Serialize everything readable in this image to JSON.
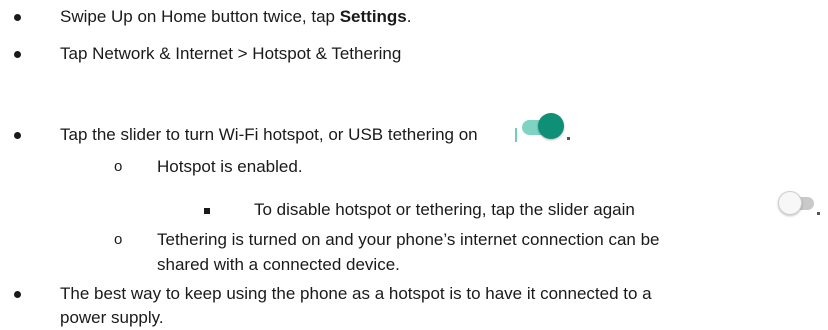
{
  "steps": {
    "step1_pre": "Swipe Up on Home button twice, tap ",
    "step1_bold": "Settings",
    "step1_post": ".",
    "step2": "Tap Network & Internet > Hotspot & Tethering",
    "step3": "Tap the slider to turn Wi-Fi hotspot, or USB tethering on",
    "sub1_marker": "o",
    "sub1": "Hotspot is enabled.",
    "subsub1": "To disable hotspot or tethering, tap the slider again",
    "sub2_marker": "o",
    "sub2_line1": "Tethering is turned on and your phone’s internet connection can be",
    "sub2_line2": "shared with a connected device.",
    "step4_line1": "The best way to keep using the phone as a hotspot is to have it connected to a",
    "step4_line2": "power supply."
  },
  "colors": {
    "toggle_on_knob": "#0e8f76",
    "toggle_on_track": "#7fd3c3",
    "toggle_off_track": "#c9c9c9",
    "toggle_off_knob": "#f7f7f7"
  },
  "icons": {
    "toggle_on": "toggle-on-icon",
    "toggle_off": "toggle-off-icon"
  }
}
